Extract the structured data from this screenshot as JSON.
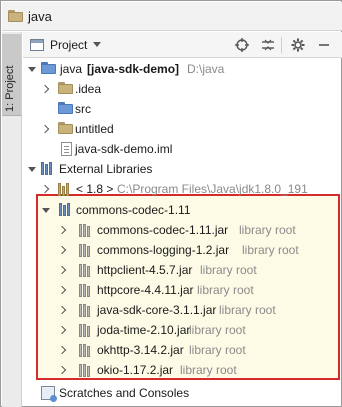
{
  "window": {
    "title": "java",
    "folder_color": "#c9b27c"
  },
  "sidebar": {
    "tab_label": "1: Project"
  },
  "toolbar": {
    "view_label": "Project",
    "icons": [
      "target-icon",
      "collapse-all-icon",
      "gear-icon",
      "minimize-icon"
    ]
  },
  "tree": {
    "root": {
      "name": "java",
      "module": "[java-sdk-demo]",
      "path": "D:\\java"
    },
    "idea": ".idea",
    "src": "src",
    "untitled": "untitled",
    "iml": "java-sdk-demo.iml",
    "external_libraries": "External Libraries",
    "jdk": {
      "name": "< 1.8 >",
      "path": "C:\\Program Files\\Java\\jdk1.8.0_191"
    },
    "codec_lib": "commons-codec-1.11",
    "jars": [
      {
        "name": "commons-codec-1.11.jar",
        "note": "library root"
      },
      {
        "name": "commons-logging-1.2.jar",
        "note": "library root"
      },
      {
        "name": "httpclient-4.5.7.jar",
        "note": "library root"
      },
      {
        "name": "httpcore-4.4.11.jar",
        "note": "library root"
      },
      {
        "name": "java-sdk-core-3.1.1.jar",
        "note": "library root"
      },
      {
        "name": "joda-time-2.10.jar",
        "note": "library root"
      },
      {
        "name": "okhttp-3.14.2.jar",
        "note": "library root"
      },
      {
        "name": "okio-1.17.2.jar",
        "note": "library root"
      }
    ],
    "scratches": "Scratches and Consoles"
  },
  "colors": {
    "highlight_border": "#d62b2b",
    "highlight_fill": "#fdfbe6",
    "muted_text": "#8a8a8a"
  }
}
